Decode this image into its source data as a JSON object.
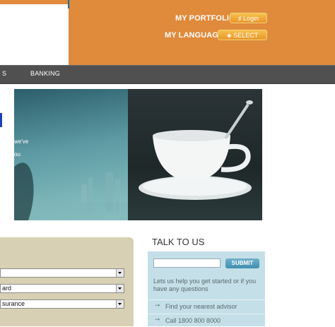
{
  "header": {
    "portfolio_label": "MY PORTFOLIO",
    "login_label": "Login",
    "language_label": "MY LANGUAGE",
    "select_label": "SELECT",
    "colors": {
      "bar": "#e08a3c",
      "button": "#f0a93a"
    }
  },
  "nav": {
    "items": [
      {
        "label": "S"
      },
      {
        "label": "BANKING"
      }
    ]
  },
  "hero": {
    "text_line1": "we've",
    "text_line2": "ou"
  },
  "form": {
    "selects": [
      {
        "value": ""
      },
      {
        "value": "ard"
      },
      {
        "value": "surance"
      }
    ]
  },
  "talk": {
    "title": "TALK TO US",
    "submit_label": "SUBMIT",
    "description": "Lets us help you get started or if you have any questions",
    "links": [
      {
        "label": "Find your nearest advisor"
      },
      {
        "label": "Call 1800 800 8000"
      }
    ]
  },
  "side_link": {
    "label": "l"
  }
}
